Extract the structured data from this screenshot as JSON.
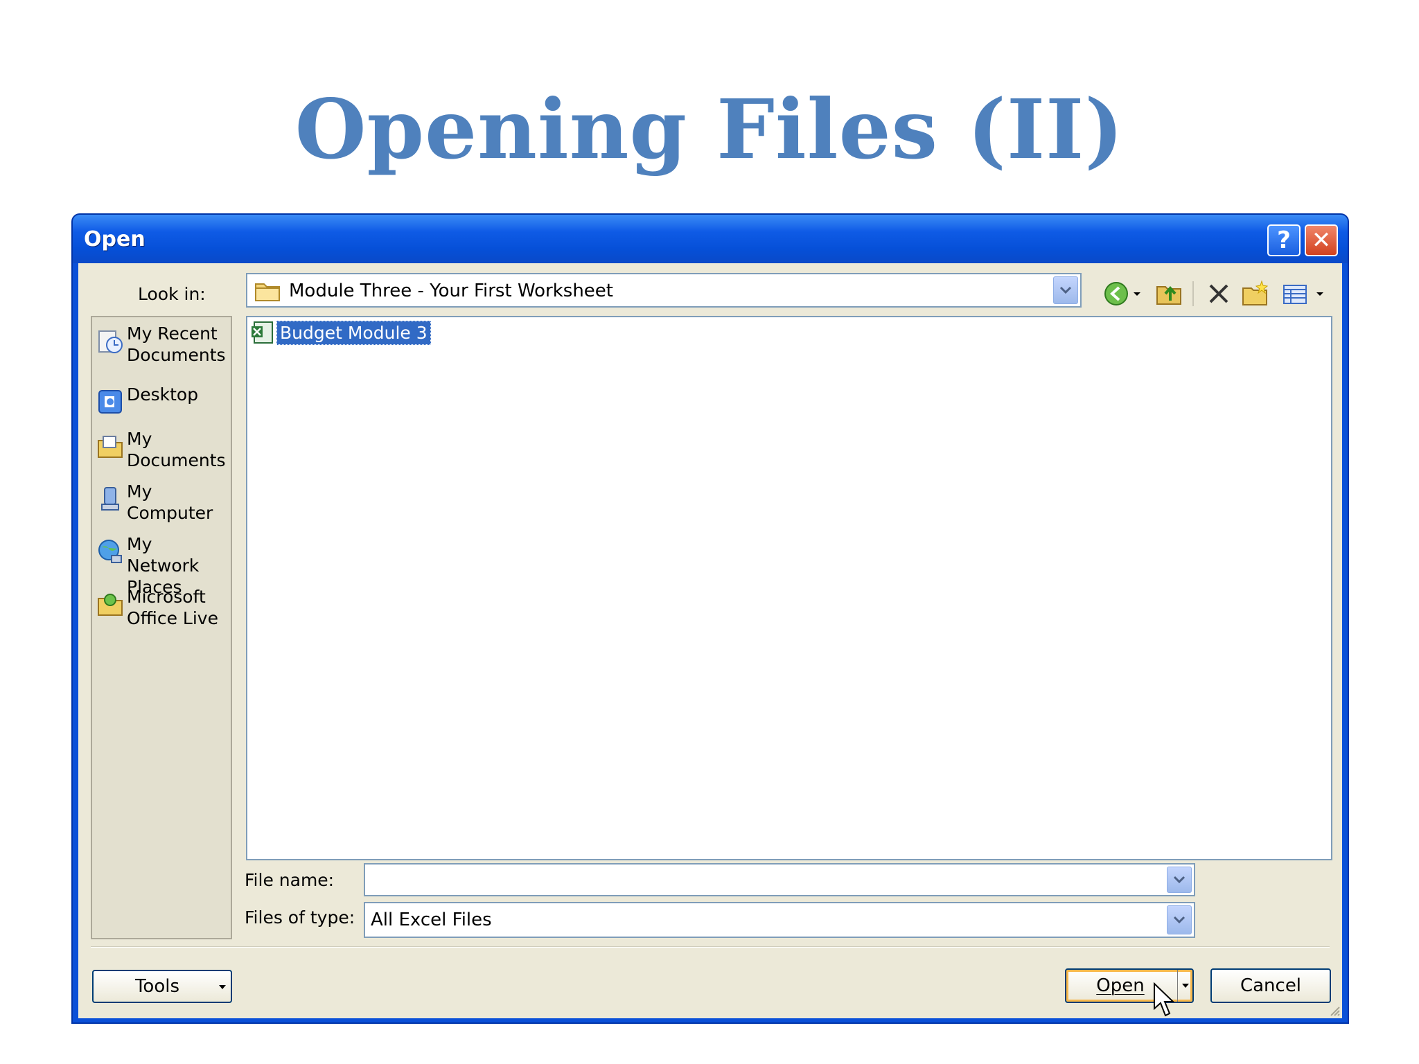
{
  "slide": {
    "title": "Opening Files (II)"
  },
  "dialog": {
    "title": "Open",
    "help_glyph": "?",
    "close_glyph": "✕",
    "lookin_label": "Look in:",
    "lookin_value": "Module Three - Your First Worksheet",
    "places": [
      {
        "label": "My Recent\nDocuments",
        "icon": "recent-documents-icon"
      },
      {
        "label": "Desktop",
        "icon": "desktop-icon"
      },
      {
        "label": "My\nDocuments",
        "icon": "my-documents-icon"
      },
      {
        "label": "My\nComputer",
        "icon": "my-computer-icon"
      },
      {
        "label": "My Network\nPlaces",
        "icon": "network-places-icon"
      },
      {
        "label": "Microsoft\nOffice Live",
        "icon": "office-live-icon"
      }
    ],
    "files": [
      {
        "name": "Budget Module 3",
        "icon": "excel-file-icon",
        "selected": true
      }
    ],
    "filename_label": "File name:",
    "filename_value": "",
    "filetype_label": "Files of type:",
    "filetype_value": "All Excel Files",
    "tools_label": "Tools",
    "open_label": "Open",
    "cancel_label": "Cancel"
  },
  "colors": {
    "title_blue": "#4f81bd",
    "titlebar_blue": "#0a50d8",
    "dialog_face": "#ece9d8",
    "selection": "#316ac5"
  }
}
